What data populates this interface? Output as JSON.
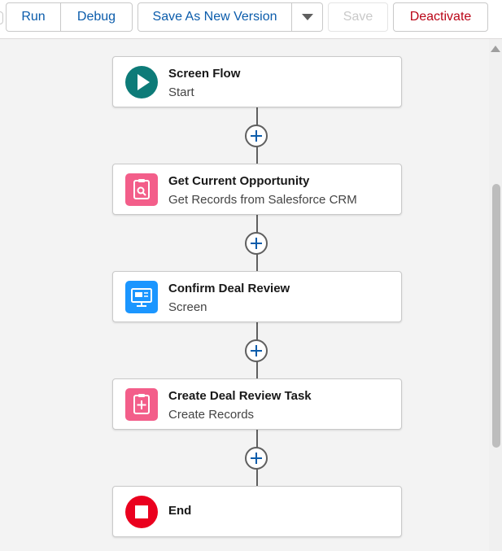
{
  "toolbar": {
    "run_label": "Run",
    "debug_label": "Debug",
    "save_as_new_label": "Save As New Version",
    "save_label": "Save",
    "deactivate_label": "Deactivate"
  },
  "flow": {
    "nodes": [
      {
        "title": "Screen Flow",
        "subtitle": "Start",
        "icon": "play-icon",
        "color": "#0d7b78"
      },
      {
        "title": "Get Current Opportunity",
        "subtitle": "Get Records from Salesforce CRM",
        "icon": "get-records-icon",
        "color": "#f35e8a"
      },
      {
        "title": "Confirm Deal Review",
        "subtitle": "Screen",
        "icon": "screen-icon",
        "color": "#1b96ff"
      },
      {
        "title": "Create Deal Review Task",
        "subtitle": "Create Records",
        "icon": "create-records-icon",
        "color": "#f35e8a"
      },
      {
        "title": "End",
        "subtitle": "",
        "icon": "stop-icon",
        "color": "#ea001e"
      }
    ]
  },
  "colors": {
    "brand_blue": "#0b5cab",
    "danger_red": "#ba0517"
  }
}
